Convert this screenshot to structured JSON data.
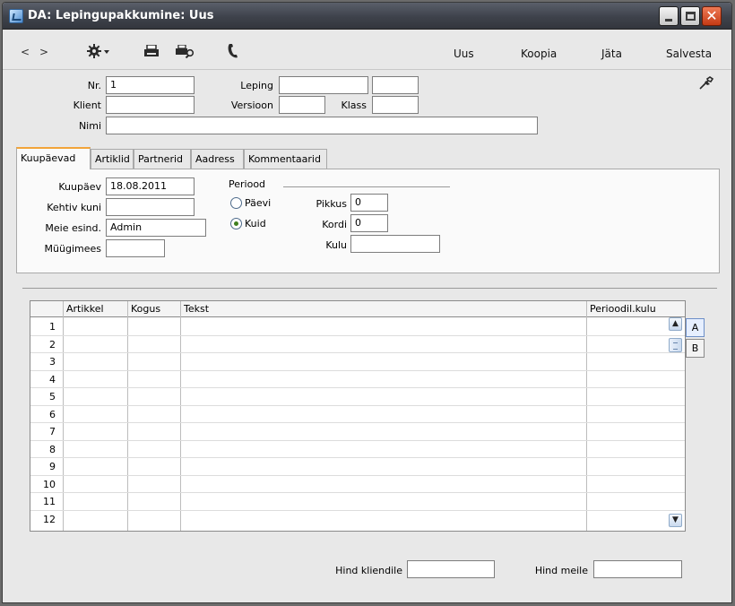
{
  "window": {
    "title": "DA: Lepingupakkumine: Uus"
  },
  "toolbar": {
    "prev": "<",
    "next": ">",
    "links": {
      "new": "Uus",
      "copy": "Koopia",
      "skip": "Jäta",
      "save": "Salvesta"
    }
  },
  "header": {
    "nr": {
      "label": "Nr.",
      "value": "1"
    },
    "leping": {
      "label": "Leping",
      "value": "",
      "value2": ""
    },
    "klient": {
      "label": "Klient",
      "value": ""
    },
    "versioon": {
      "label": "Versioon",
      "value": ""
    },
    "klass": {
      "label": "Klass",
      "value": ""
    },
    "nimi": {
      "label": "Nimi",
      "value": ""
    }
  },
  "tabs": [
    "Kuupäevad",
    "Artiklid",
    "Partnerid",
    "Aadress",
    "Kommentaarid"
  ],
  "active_tab": "Kuupäevad",
  "dates_tab": {
    "kuupaev": {
      "label": "Kuupäev",
      "value": "18.08.2011"
    },
    "kehtiv_kuni": {
      "label": "Kehtiv kuni",
      "value": ""
    },
    "meie_esind": {
      "label": "Meie esind.",
      "value": "Admin"
    },
    "muugimees": {
      "label": "Müügimees",
      "value": ""
    },
    "periood": {
      "label": "Periood",
      "option_days": "Päevi",
      "option_months": "Kuid",
      "selected": "Kuid"
    },
    "pikkus": {
      "label": "Pikkus",
      "value": "0"
    },
    "kordi": {
      "label": "Kordi",
      "value": "0"
    },
    "kulu": {
      "label": "Kulu",
      "value": ""
    }
  },
  "grid": {
    "columns": [
      "Artikkel",
      "Kogus",
      "Tekst",
      "Perioodil.kulu"
    ],
    "row_numbers": [
      "1",
      "2",
      "3",
      "4",
      "5",
      "6",
      "7",
      "8",
      "9",
      "10",
      "11",
      "12"
    ],
    "side_tabs": [
      "A",
      "B"
    ]
  },
  "footer": {
    "hind_kliendile": {
      "label": "Hind kliendile",
      "value": ""
    },
    "hind_meile": {
      "label": "Hind meile",
      "value": ""
    }
  }
}
